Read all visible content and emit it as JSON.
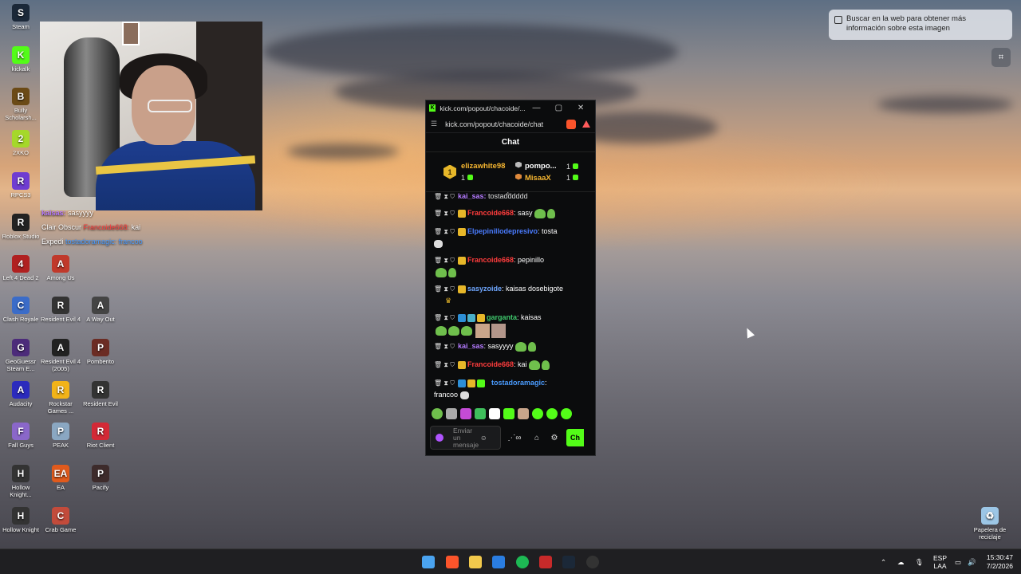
{
  "desktop": {
    "icons": [
      {
        "label": "Steam",
        "color": "#1b2838",
        "glyph": "S"
      },
      {
        "label": "kickalk",
        "color": "#53fc18",
        "glyph": "K"
      },
      {
        "label": "Bully Scholarsh...",
        "color": "#6b4a16",
        "glyph": "B"
      },
      {
        "label": "2XKO",
        "color": "#a5d82a",
        "glyph": "2"
      },
      {
        "label": "RPCS3",
        "color": "#6f3cd1",
        "glyph": "R"
      },
      {
        "label": "Roblox Studio",
        "color": "#222",
        "glyph": "R"
      },
      {
        "label": "Left 4 Dead 2",
        "color": "#b02020",
        "glyph": "4"
      },
      {
        "label": "Clash Royale",
        "color": "#3b6cc8",
        "glyph": "C"
      },
      {
        "label": "GeoGuessr Steam E...",
        "color": "#4c2b7a",
        "glyph": "G"
      },
      {
        "label": "Audacity",
        "color": "#2b2bbd",
        "glyph": "A"
      },
      {
        "label": "Fall Guys",
        "color": "#8a67c9",
        "glyph": "F"
      },
      {
        "label": "Hollow Knight...",
        "color": "#333",
        "glyph": "H"
      },
      {
        "label": "Hollow Knight",
        "color": "#333",
        "glyph": "H"
      },
      {
        "label": "Among Us",
        "color": "#c0392b",
        "glyph": "A"
      },
      {
        "label": "Resident Evil 4",
        "color": "#333",
        "glyph": "R"
      },
      {
        "label": "Resident Evil 4 (2005)",
        "color": "#222",
        "glyph": "A"
      },
      {
        "label": "Rockstar Games ...",
        "color": "#f2b318",
        "glyph": "R"
      },
      {
        "label": "PEAK",
        "color": "#8aa7c2",
        "glyph": "P"
      },
      {
        "label": "EA",
        "color": "#e05a1c",
        "glyph": "EA"
      },
      {
        "label": "Crab Game",
        "color": "#c24b3b",
        "glyph": "C"
      },
      {
        "label": "A Way Out",
        "color": "#444",
        "glyph": "A"
      },
      {
        "label": "Pomberito",
        "color": "#6b2c24",
        "glyph": "P"
      },
      {
        "label": "Resident Evil",
        "color": "#333",
        "glyph": "R"
      },
      {
        "label": "Riot Client",
        "color": "#d32936",
        "glyph": "R"
      },
      {
        "label": "Pacify",
        "color": "#3d2b2b",
        "glyph": "P"
      },
      {
        "label": "Papelera de reciclaje",
        "color": "#9cc6e6",
        "glyph": "♻"
      }
    ],
    "overlay_chat": [
      {
        "user": "kaisas:",
        "text": "sasyyyy"
      },
      {
        "user": "Clair Obscur",
        "text": "kai"
      },
      {
        "user": "Expedi",
        "text": "tostadoramagic: francoo"
      }
    ]
  },
  "lens_tooltip": {
    "text": "Buscar en la web para obtener más información sobre esta imagen"
  },
  "popup": {
    "title": "kick.com/popout/chacoide/...",
    "url": "kick.com/popout/chacoide/chat",
    "chat_title": "Chat",
    "gifters": [
      {
        "rank": "1",
        "name": "elizawhite98",
        "count": "1"
      },
      {
        "name": "pompo...",
        "count": "1"
      },
      {
        "name": "MisaaX",
        "count": "1"
      }
    ],
    "messages": [
      {
        "user": "kai_sas:",
        "text": "tostadddddd",
        "color": "#b57bff"
      },
      {
        "user": "Francoide668",
        "text": ": sasy",
        "color": "#ff3d3d"
      },
      {
        "user": "Elpepinillodepresivo",
        "text": ": tosta",
        "color": "#4a7cff"
      },
      {
        "user": "Francoide668",
        "text": ": pepinillo",
        "color": "#ff3d3d"
      },
      {
        "user": "sasyzoide",
        "text": ": kaisas dosebigote",
        "color": "#6fa7ff"
      },
      {
        "user": "garganta",
        "text": ": kaisas",
        "color": "#3fc76c"
      },
      {
        "user": "kai_sas",
        "text": ": sasyyyy",
        "color": "#b57bff"
      },
      {
        "user": "Francoide668",
        "text": ": kai",
        "color": "#ff3d3d"
      },
      {
        "user": "tostadoramagic",
        "text": ":",
        "color": "#4a9cff"
      },
      {
        "user": "",
        "text": "francoo",
        "color": "#fff"
      }
    ],
    "input_placeholder": "Enviar un mensaje",
    "chat_button": "Ch"
  },
  "taskbar": {
    "lang_top": "ESP",
    "lang_bottom": "LAA",
    "time": "15:30:47",
    "date": "7/2/2026"
  }
}
